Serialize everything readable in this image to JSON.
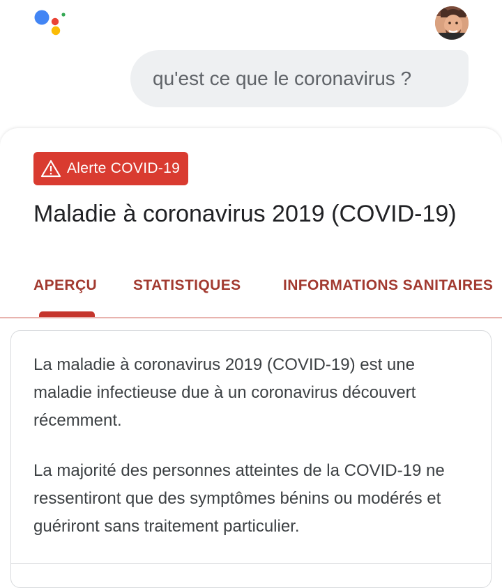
{
  "query": {
    "text": "qu'est ce que le coronavirus ?"
  },
  "card": {
    "alert_label": "Alerte COVID-19",
    "title": "Maladie à coronavirus 2019 (COVID-19)",
    "tabs": [
      {
        "label": "APERÇU",
        "selected": true
      },
      {
        "label": "STATISTIQUES",
        "selected": false
      },
      {
        "label": "INFORMATIONS SANITAIRES",
        "selected": false
      }
    ],
    "paragraphs": [
      "La maladie à coronavirus 2019 (COVID-19) est une maladie infectieuse due à un coronavirus découvert récemment.",
      "La majorité des personnes atteintes de la COVID-19 ne ressentiront que des symptômes bénins ou modérés et guériront sans traitement particulier."
    ]
  },
  "icons": {
    "assistant": "google-assistant-icon",
    "alert": "warning-triangle-icon"
  },
  "colors": {
    "alert_bg": "#d93b30",
    "tab_text": "#a23a30",
    "tab_indicator": "#c5352c",
    "query_bubble": "#eef0f2"
  }
}
